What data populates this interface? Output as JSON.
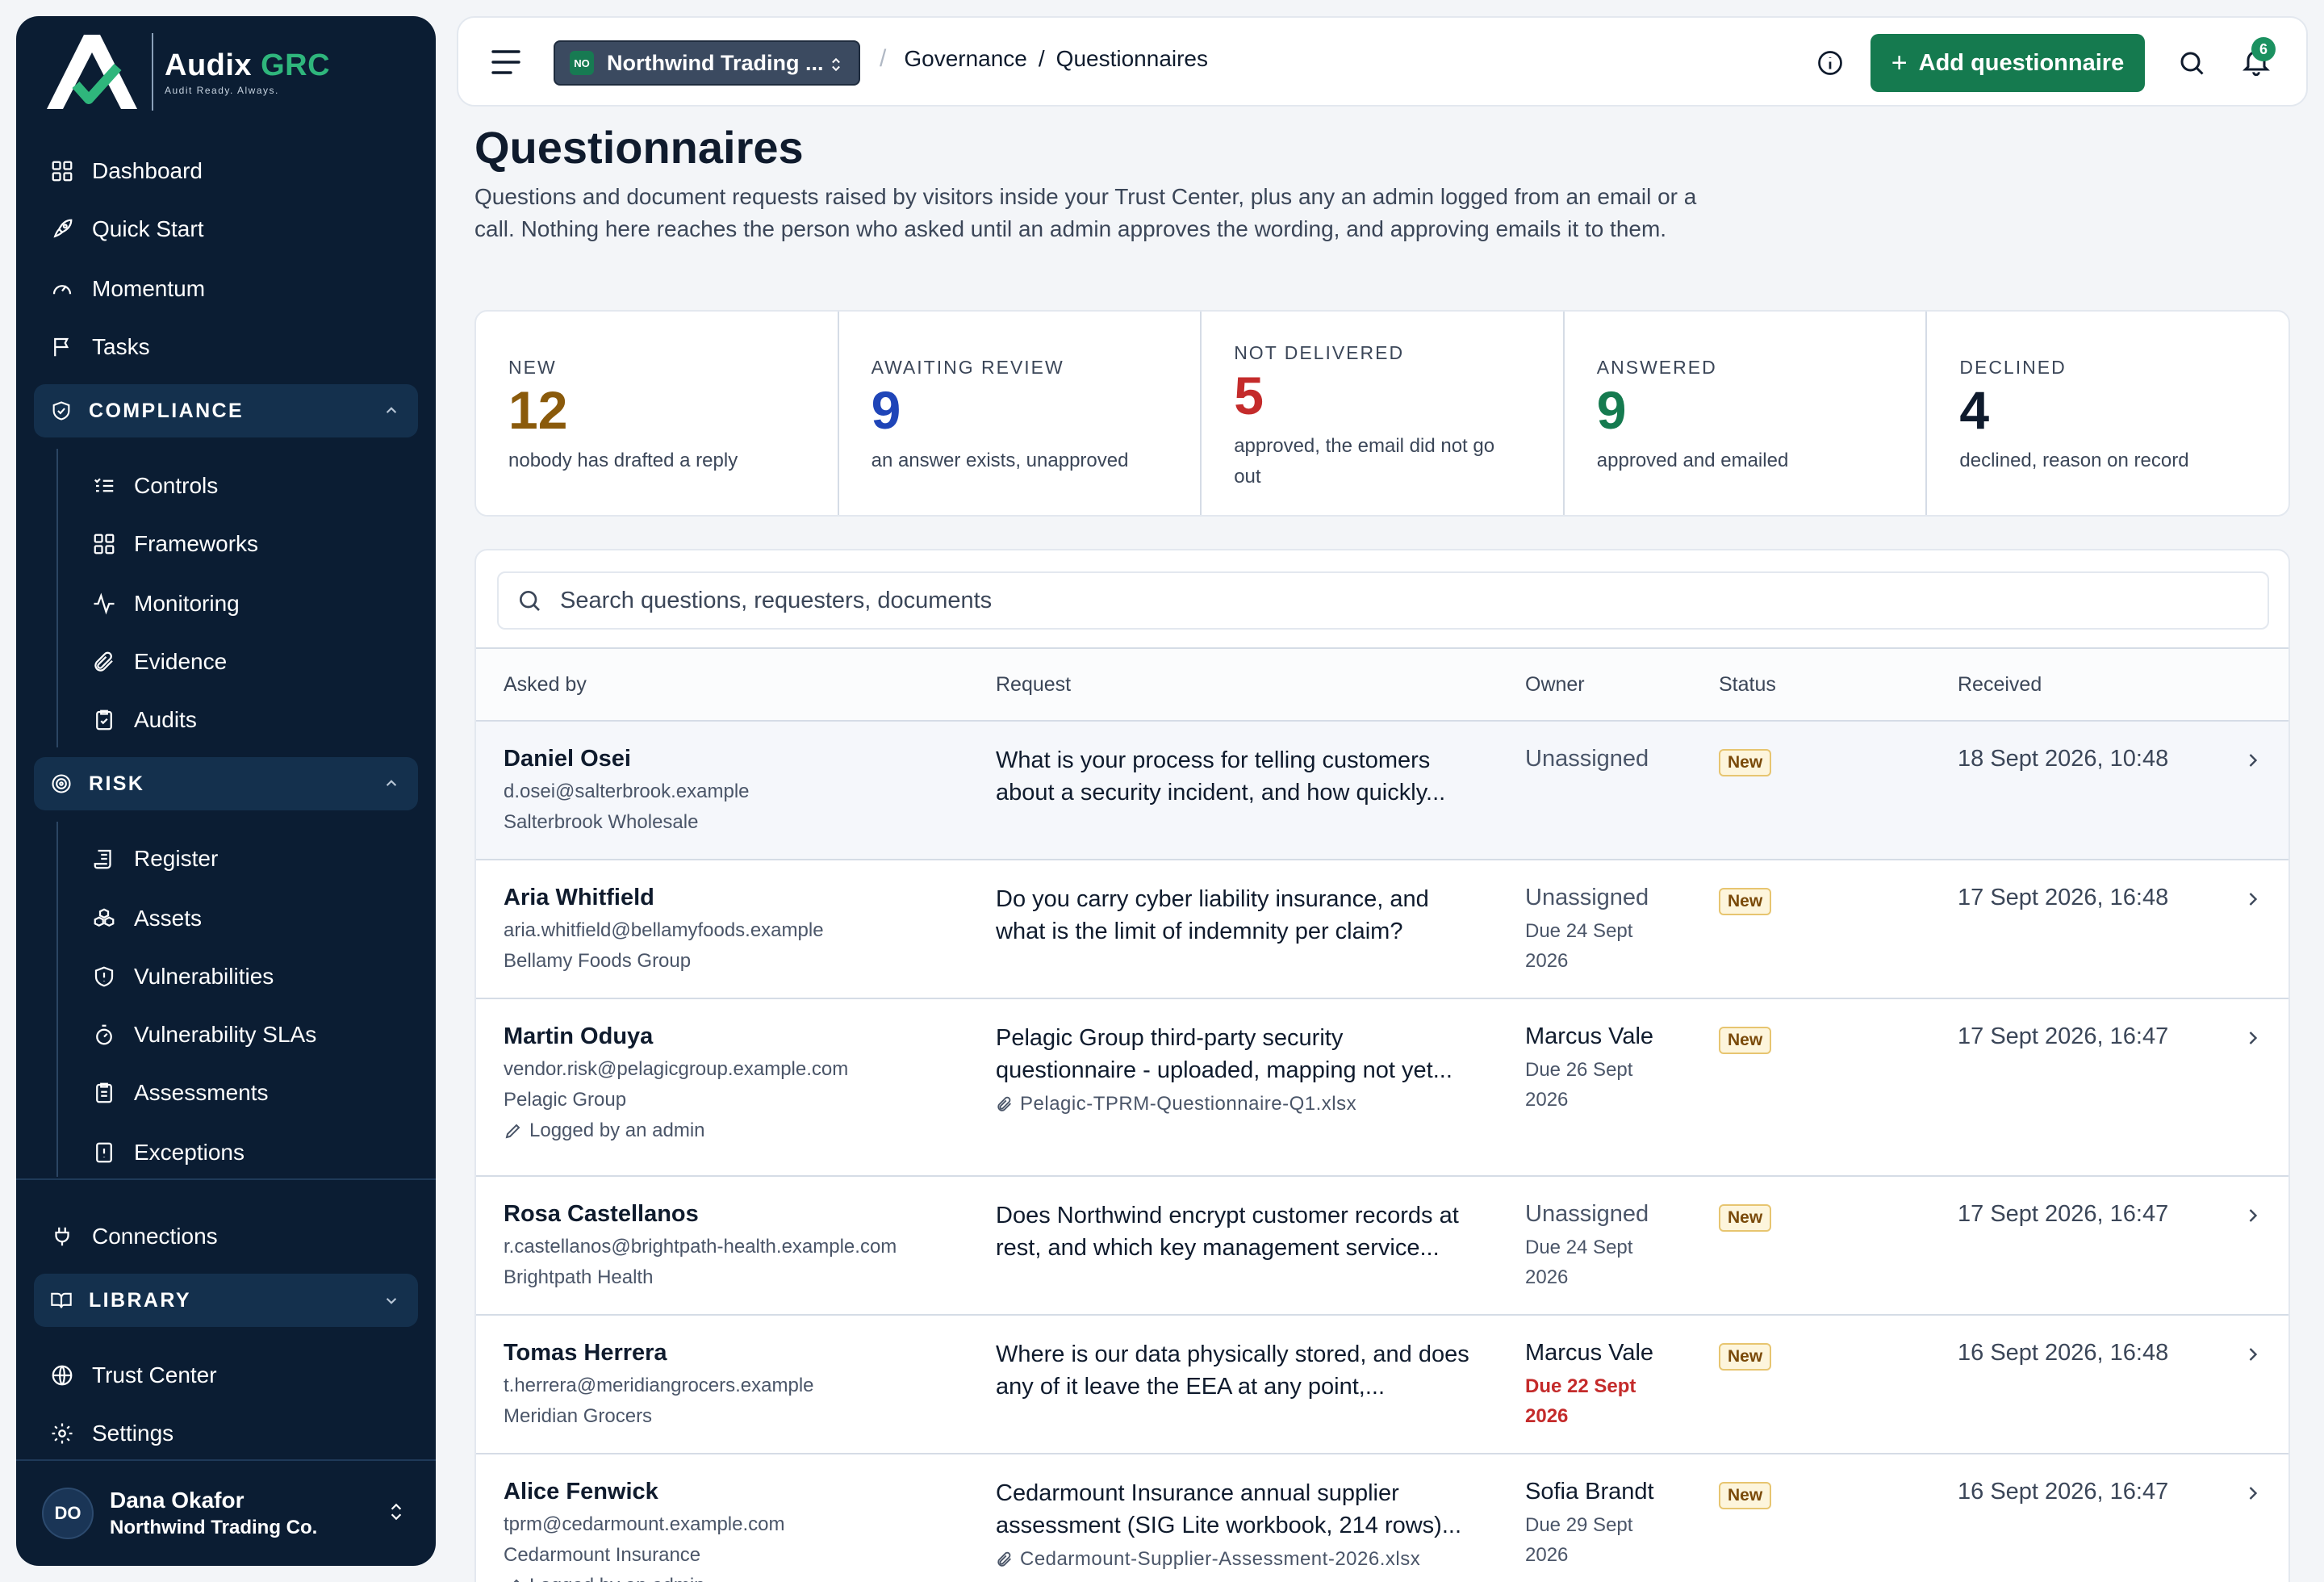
{
  "brand": {
    "name_main": "Audix",
    "name_accent": "GRC",
    "tagline": "Audit Ready. Always."
  },
  "sidebar": {
    "top_items": [
      {
        "label": "Dashboard",
        "icon": "grid-icon"
      },
      {
        "label": "Quick Start",
        "icon": "rocket-icon"
      },
      {
        "label": "Momentum",
        "icon": "gauge-icon"
      },
      {
        "label": "Tasks",
        "icon": "flag-icon"
      }
    ],
    "compliance": {
      "label": "COMPLIANCE",
      "items": [
        {
          "label": "Controls"
        },
        {
          "label": "Frameworks"
        },
        {
          "label": "Monitoring"
        },
        {
          "label": "Evidence"
        },
        {
          "label": "Audits"
        }
      ]
    },
    "risk": {
      "label": "RISK",
      "items": [
        {
          "label": "Register"
        },
        {
          "label": "Assets"
        },
        {
          "label": "Vulnerabilities"
        },
        {
          "label": "Vulnerability SLAs"
        },
        {
          "label": "Assessments"
        },
        {
          "label": "Exceptions"
        }
      ]
    },
    "connections": "Connections",
    "library": {
      "label": "LIBRARY"
    },
    "trust_center": "Trust Center",
    "settings": "Settings",
    "user": {
      "initials": "DO",
      "name": "Dana Okafor",
      "org": "Northwind Trading Co."
    }
  },
  "topbar": {
    "org_badge": "NO",
    "org_name": "Northwind Trading ...",
    "breadcrumb": [
      "Governance",
      "Questionnaires"
    ],
    "add_button": "Add questionnaire",
    "notifications": "6"
  },
  "page": {
    "title": "Questionnaires",
    "description": "Questions and document requests raised by visitors inside your Trust Center, plus any an admin logged from an email or a call. Nothing here reaches the person who asked until an admin approves the wording, and approving emails it to them."
  },
  "stats": [
    {
      "label": "NEW",
      "value": "12",
      "sub": "nobody has drafted a reply",
      "color": "#8a5a0b"
    },
    {
      "label": "AWAITING REVIEW",
      "value": "9",
      "sub": "an answer exists, unapproved",
      "color": "#1f45b8"
    },
    {
      "label": "NOT DELIVERED",
      "value": "5",
      "sub": "approved, the email did not go out",
      "color": "#c42b2b"
    },
    {
      "label": "ANSWERED",
      "value": "9",
      "sub": "approved and emailed",
      "color": "#157a4f"
    },
    {
      "label": "DECLINED",
      "value": "4",
      "sub": "declined, reason on record",
      "color": "#0f1b2d"
    }
  ],
  "table": {
    "search_placeholder": "Search questions, requesters, documents",
    "columns": [
      "Asked by",
      "Request",
      "Owner",
      "Status",
      "Received"
    ],
    "rows": [
      {
        "name": "Daniel Osei",
        "email": "d.osei@salterbrook.example",
        "org": "Salterbrook Wholesale",
        "note": "",
        "request": "What is your process for telling customers about a security incident, and how quickly...",
        "file": "",
        "owner": "Unassigned",
        "due": "",
        "status": "New",
        "received": "18 Sept 2026, 10:48"
      },
      {
        "name": "Aria Whitfield",
        "email": "aria.whitfield@bellamyfoods.example",
        "org": "Bellamy Foods Group",
        "note": "",
        "request": "Do you carry cyber liability insurance, and what is the limit of indemnity per claim?",
        "file": "",
        "owner": "Unassigned",
        "due": "Due 24 Sept 2026",
        "status": "New",
        "received": "17 Sept 2026, 16:48"
      },
      {
        "name": "Martin Oduya",
        "email": "vendor.risk@pelagicgroup.example.com",
        "org": "Pelagic Group",
        "note": "Logged by an admin",
        "request": "Pelagic Group third-party security questionnaire - uploaded, mapping not yet...",
        "file": "Pelagic-TPRM-Questionnaire-Q1.xlsx",
        "owner": "Marcus Vale",
        "due": "Due 26 Sept 2026",
        "status": "New",
        "received": "17 Sept 2026, 16:47"
      },
      {
        "name": "Rosa Castellanos",
        "email": "r.castellanos@brightpath-health.example.com",
        "org": "Brightpath Health",
        "note": "",
        "request": "Does Northwind encrypt customer records at rest, and which key management service...",
        "file": "",
        "owner": "Unassigned",
        "due": "Due 24 Sept 2026",
        "status": "New",
        "received": "17 Sept 2026, 16:47"
      },
      {
        "name": "Tomas Herrera",
        "email": "t.herrera@meridiangrocers.example",
        "org": "Meridian Grocers",
        "note": "",
        "request": "Where is our data physically stored, and does any of it leave the EEA at any point,...",
        "file": "",
        "owner": "Marcus Vale",
        "due": "Due 22 Sept 2026",
        "status": "New",
        "received": "16 Sept 2026, 16:48",
        "overdue": "true"
      },
      {
        "name": "Alice Fenwick",
        "email": "tprm@cedarmount.example.com",
        "org": "Cedarmount Insurance",
        "note": "Logged by an admin",
        "request": "Cedarmount Insurance annual supplier assessment (SIG Lite workbook, 214 rows)...",
        "file": "Cedarmount-Supplier-Assessment-2026.xlsx",
        "owner": "Sofia Brandt",
        "due": "Due 29 Sept 2026",
        "status": "New",
        "received": "16 Sept 2026, 16:47"
      }
    ]
  }
}
